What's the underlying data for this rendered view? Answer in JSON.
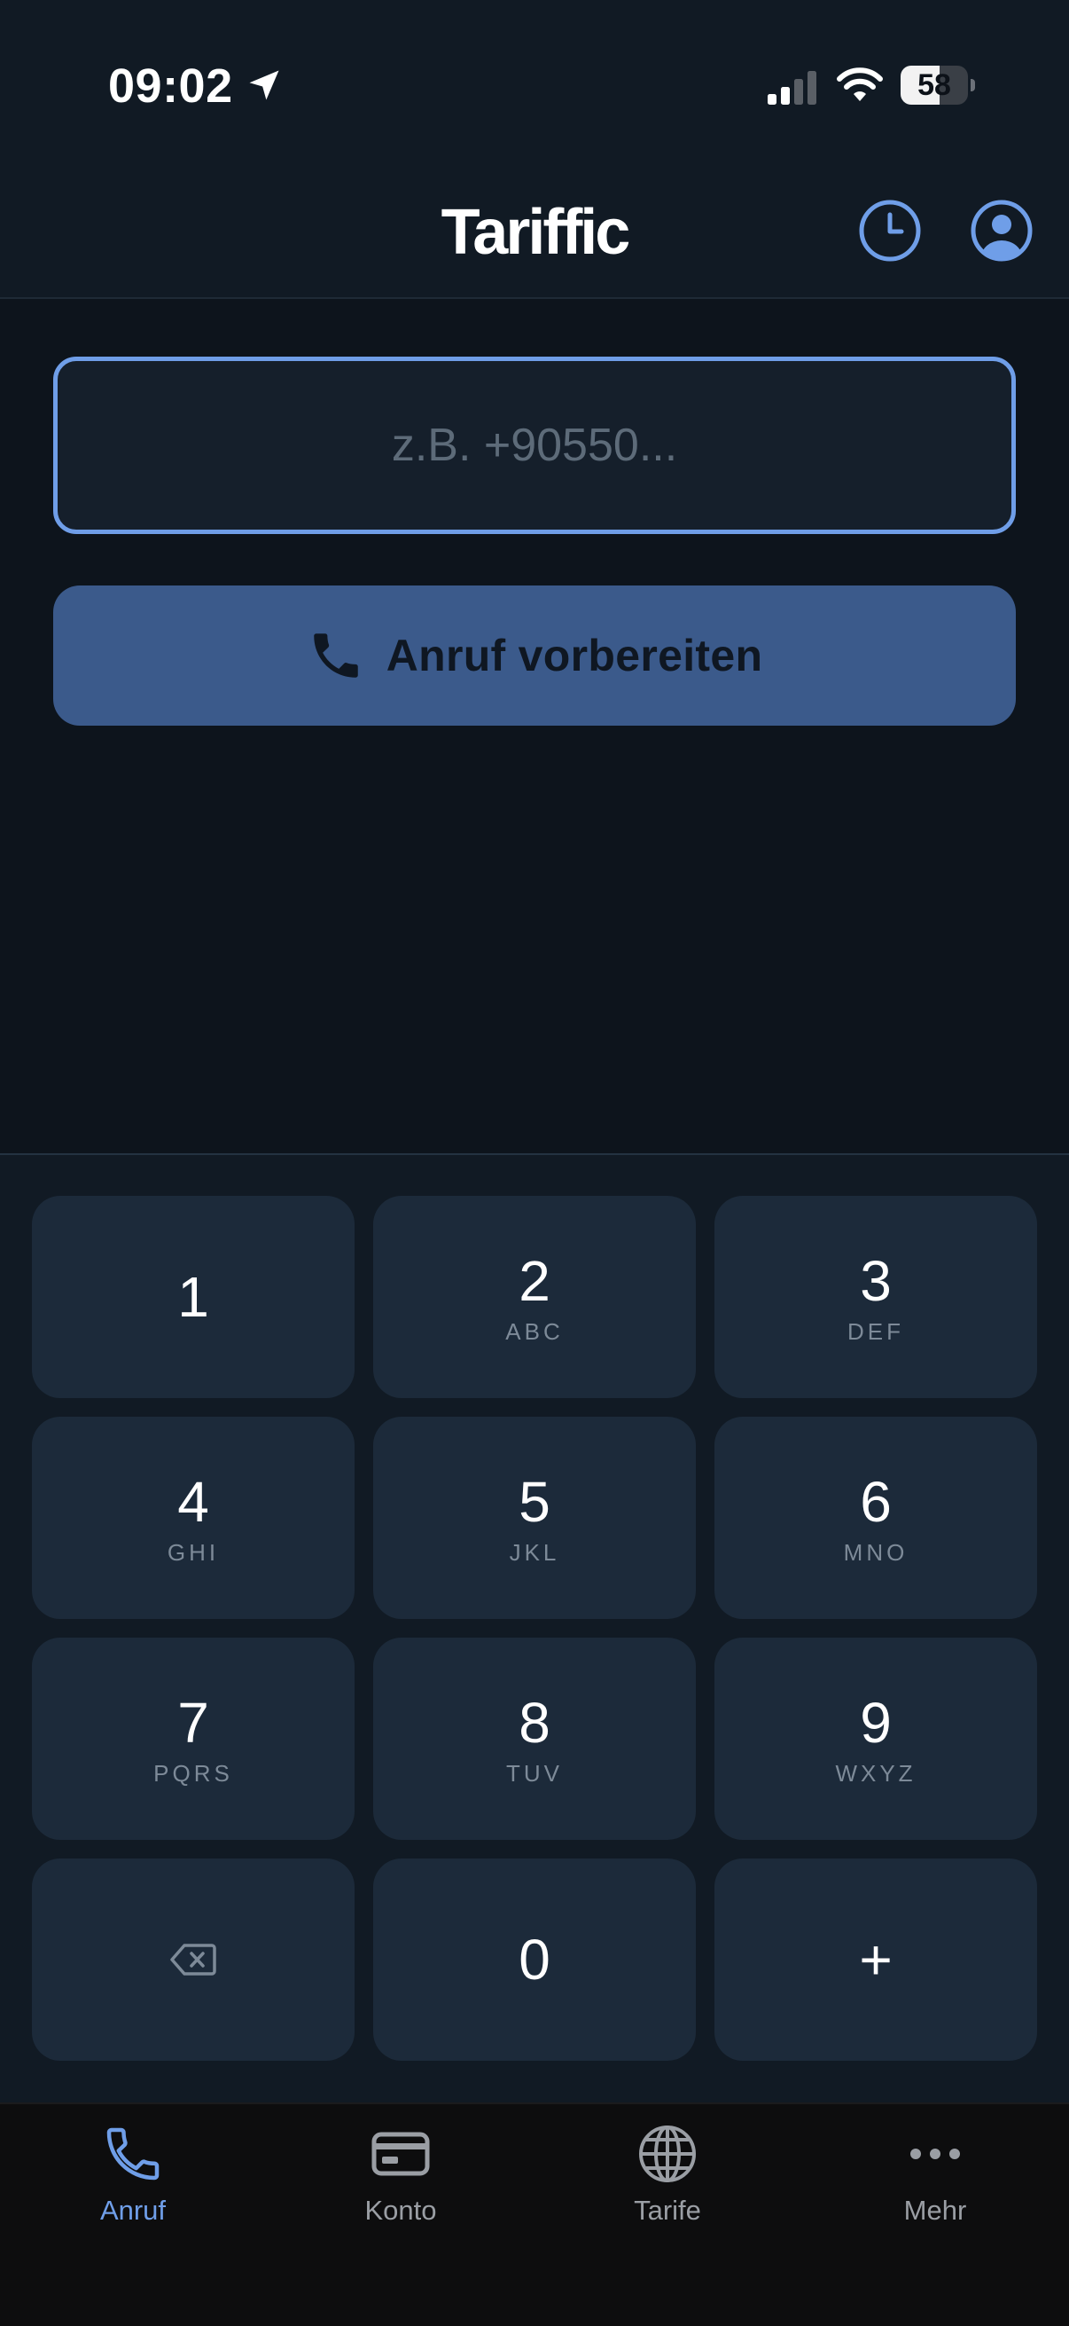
{
  "status_bar": {
    "time": "09:02",
    "battery_level": "58",
    "battery_fraction": 0.58
  },
  "header": {
    "logo_text": "Tariffic",
    "icons": [
      "clock-icon",
      "user-circle-icon"
    ]
  },
  "dialer": {
    "input_value": "",
    "input_placeholder": "z.B. +90550...",
    "prepare_call_label": "Anruf vorbereiten"
  },
  "keypad": {
    "keys": [
      {
        "digit": "1",
        "letters": ""
      },
      {
        "digit": "2",
        "letters": "ABC"
      },
      {
        "digit": "3",
        "letters": "DEF"
      },
      {
        "digit": "4",
        "letters": "GHI"
      },
      {
        "digit": "5",
        "letters": "JKL"
      },
      {
        "digit": "6",
        "letters": "MNO"
      },
      {
        "digit": "7",
        "letters": "PQRS"
      },
      {
        "digit": "8",
        "letters": "TUV"
      },
      {
        "digit": "9",
        "letters": "WXYZ"
      },
      {
        "digit": "",
        "letters": "",
        "icon": "backspace-icon"
      },
      {
        "digit": "0",
        "letters": ""
      },
      {
        "digit": "+",
        "letters": ""
      }
    ]
  },
  "tabbar": {
    "tabs": [
      {
        "label": "Anruf",
        "icon": "phone-icon",
        "active": true
      },
      {
        "label": "Konto",
        "icon": "credit-card-icon",
        "active": false
      },
      {
        "label": "Tarife",
        "icon": "globe-icon",
        "active": false
      },
      {
        "label": "Mehr",
        "icon": "more-dots-icon",
        "active": false
      }
    ]
  },
  "colors": {
    "accent": "#6f9ee8",
    "button": "#3b5a8b",
    "key_background": "#1c2a3a",
    "background": "#0d141c"
  }
}
